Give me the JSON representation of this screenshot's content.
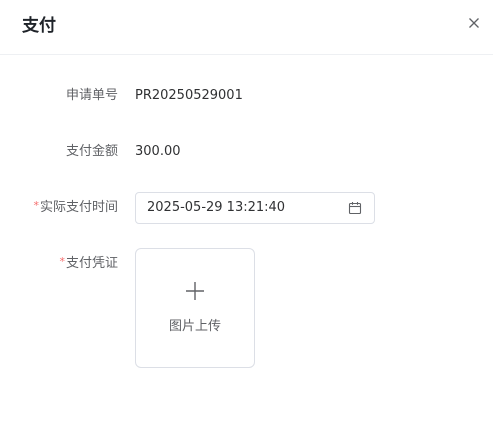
{
  "dialog": {
    "title": "支付",
    "close_icon": "close-icon"
  },
  "form": {
    "application_no": {
      "label": "申请单号",
      "value": "PR20250529001"
    },
    "amount": {
      "label": "支付金额",
      "value": "300.00"
    },
    "pay_time": {
      "required_mark": "*",
      "label": "实际支付时间",
      "value": "2025-05-29 13:21:40",
      "icon": "calendar-icon"
    },
    "voucher": {
      "required_mark": "*",
      "label": "支付凭证",
      "upload_label": "图片上传",
      "icon": "plus-icon"
    }
  },
  "colors": {
    "required": "#f56c6c",
    "border": "#dcdfe6",
    "label": "#606266",
    "text": "#303133"
  }
}
